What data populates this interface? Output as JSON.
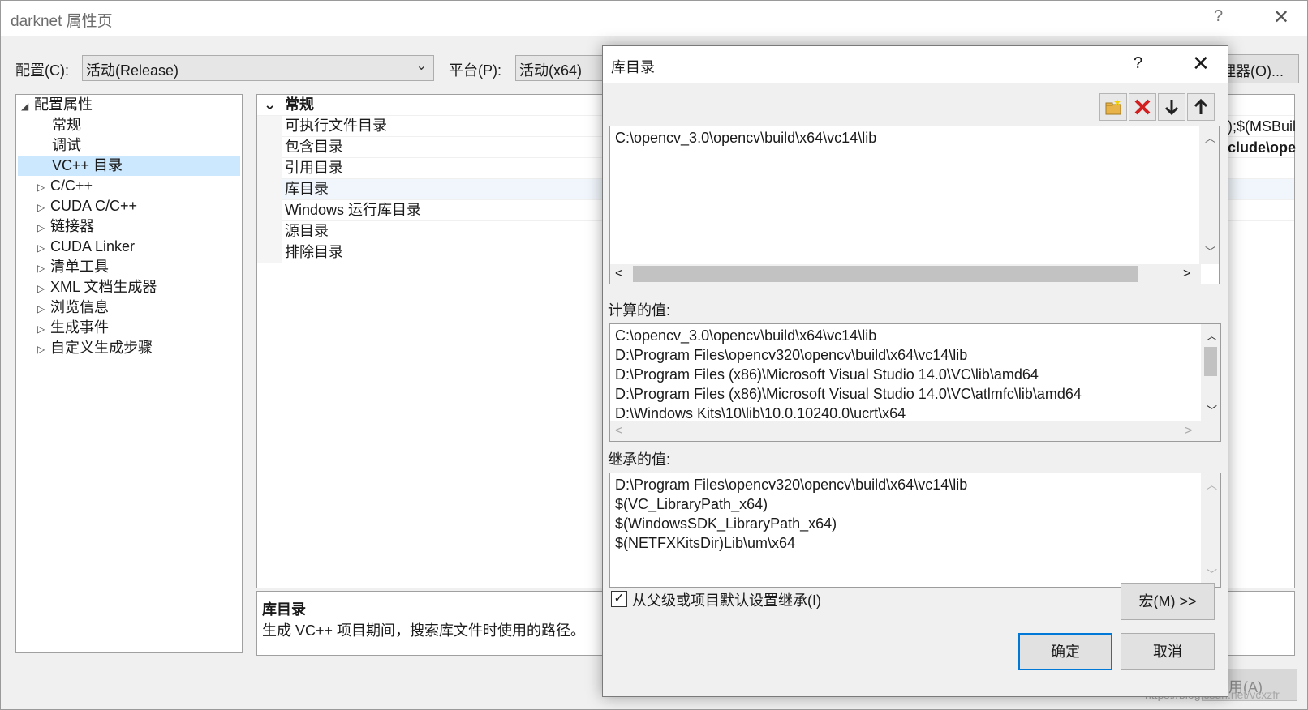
{
  "window": {
    "title": "darknet 属性页",
    "help": "?",
    "close": "✕"
  },
  "toolbar": {
    "config_label": "配置(C):",
    "config_value": "活动(Release)",
    "platform_label": "平台(P):",
    "platform_value": "活动(x64)",
    "manager_button": "理器(O)..."
  },
  "tree": {
    "items": [
      {
        "label": "配置属性",
        "expander": "◢"
      },
      {
        "label": "常规",
        "expander": ""
      },
      {
        "label": "调试",
        "expander": ""
      },
      {
        "label": "VC++ 目录",
        "expander": ""
      },
      {
        "label": "C/C++",
        "expander": "▷"
      },
      {
        "label": "CUDA C/C++",
        "expander": "▷"
      },
      {
        "label": "链接器",
        "expander": "▷"
      },
      {
        "label": "CUDA Linker",
        "expander": "▷"
      },
      {
        "label": "清单工具",
        "expander": "▷"
      },
      {
        "label": "XML 文档生成器",
        "expander": "▷"
      },
      {
        "label": "浏览信息",
        "expander": "▷"
      },
      {
        "label": "生成事件",
        "expander": "▷"
      },
      {
        "label": "自定义生成步骤",
        "expander": "▷"
      }
    ]
  },
  "grid": {
    "category": "常规",
    "category_toggle": "⌄",
    "rows": [
      "可执行文件目录",
      "包含目录",
      "引用目录",
      "库目录",
      "Windows 运行库目录",
      "源目录",
      "排除目录"
    ],
    "value_fragment_1": ");$(MSBuil",
    "value_fragment_2": "clude\\ope"
  },
  "description": {
    "title": "库目录",
    "text": "生成 VC++ 项目期间，搜索库文件时使用的路径。"
  },
  "apply_button": "应用(A)",
  "watermark": "https://blog.csdn.net/vcxzfr",
  "dialog": {
    "title": "库目录",
    "help": "?",
    "close": "✕",
    "tool_icons": [
      "new-folder-icon",
      "delete-icon",
      "move-down-icon",
      "move-up-icon"
    ],
    "edit_lines": [
      "C:\\opencv_3.0\\opencv\\build\\x64\\vc14\\lib"
    ],
    "computed_label": "计算的值:",
    "computed_lines": [
      "C:\\opencv_3.0\\opencv\\build\\x64\\vc14\\lib",
      "D:\\Program Files\\opencv320\\opencv\\build\\x64\\vc14\\lib",
      "D:\\Program Files (x86)\\Microsoft Visual Studio 14.0\\VC\\lib\\amd64",
      "D:\\Program Files (x86)\\Microsoft Visual Studio 14.0\\VC\\atlmfc\\lib\\amd64",
      "D:\\Windows Kits\\10\\lib\\10.0.10240.0\\ucrt\\x64"
    ],
    "inherited_label": "继承的值:",
    "inherited_lines": [
      "D:\\Program Files\\opencv320\\opencv\\build\\x64\\vc14\\lib",
      "$(VC_LibraryPath_x64)",
      "$(WindowsSDK_LibraryPath_x64)",
      "$(NETFXKitsDir)Lib\\um\\x64"
    ],
    "inherit_checkbox_label": "从父级或项目默认设置继承(I)",
    "inherit_checked": true,
    "macro_button": "宏(M) >>",
    "ok_button": "确定",
    "cancel_button": "取消"
  }
}
